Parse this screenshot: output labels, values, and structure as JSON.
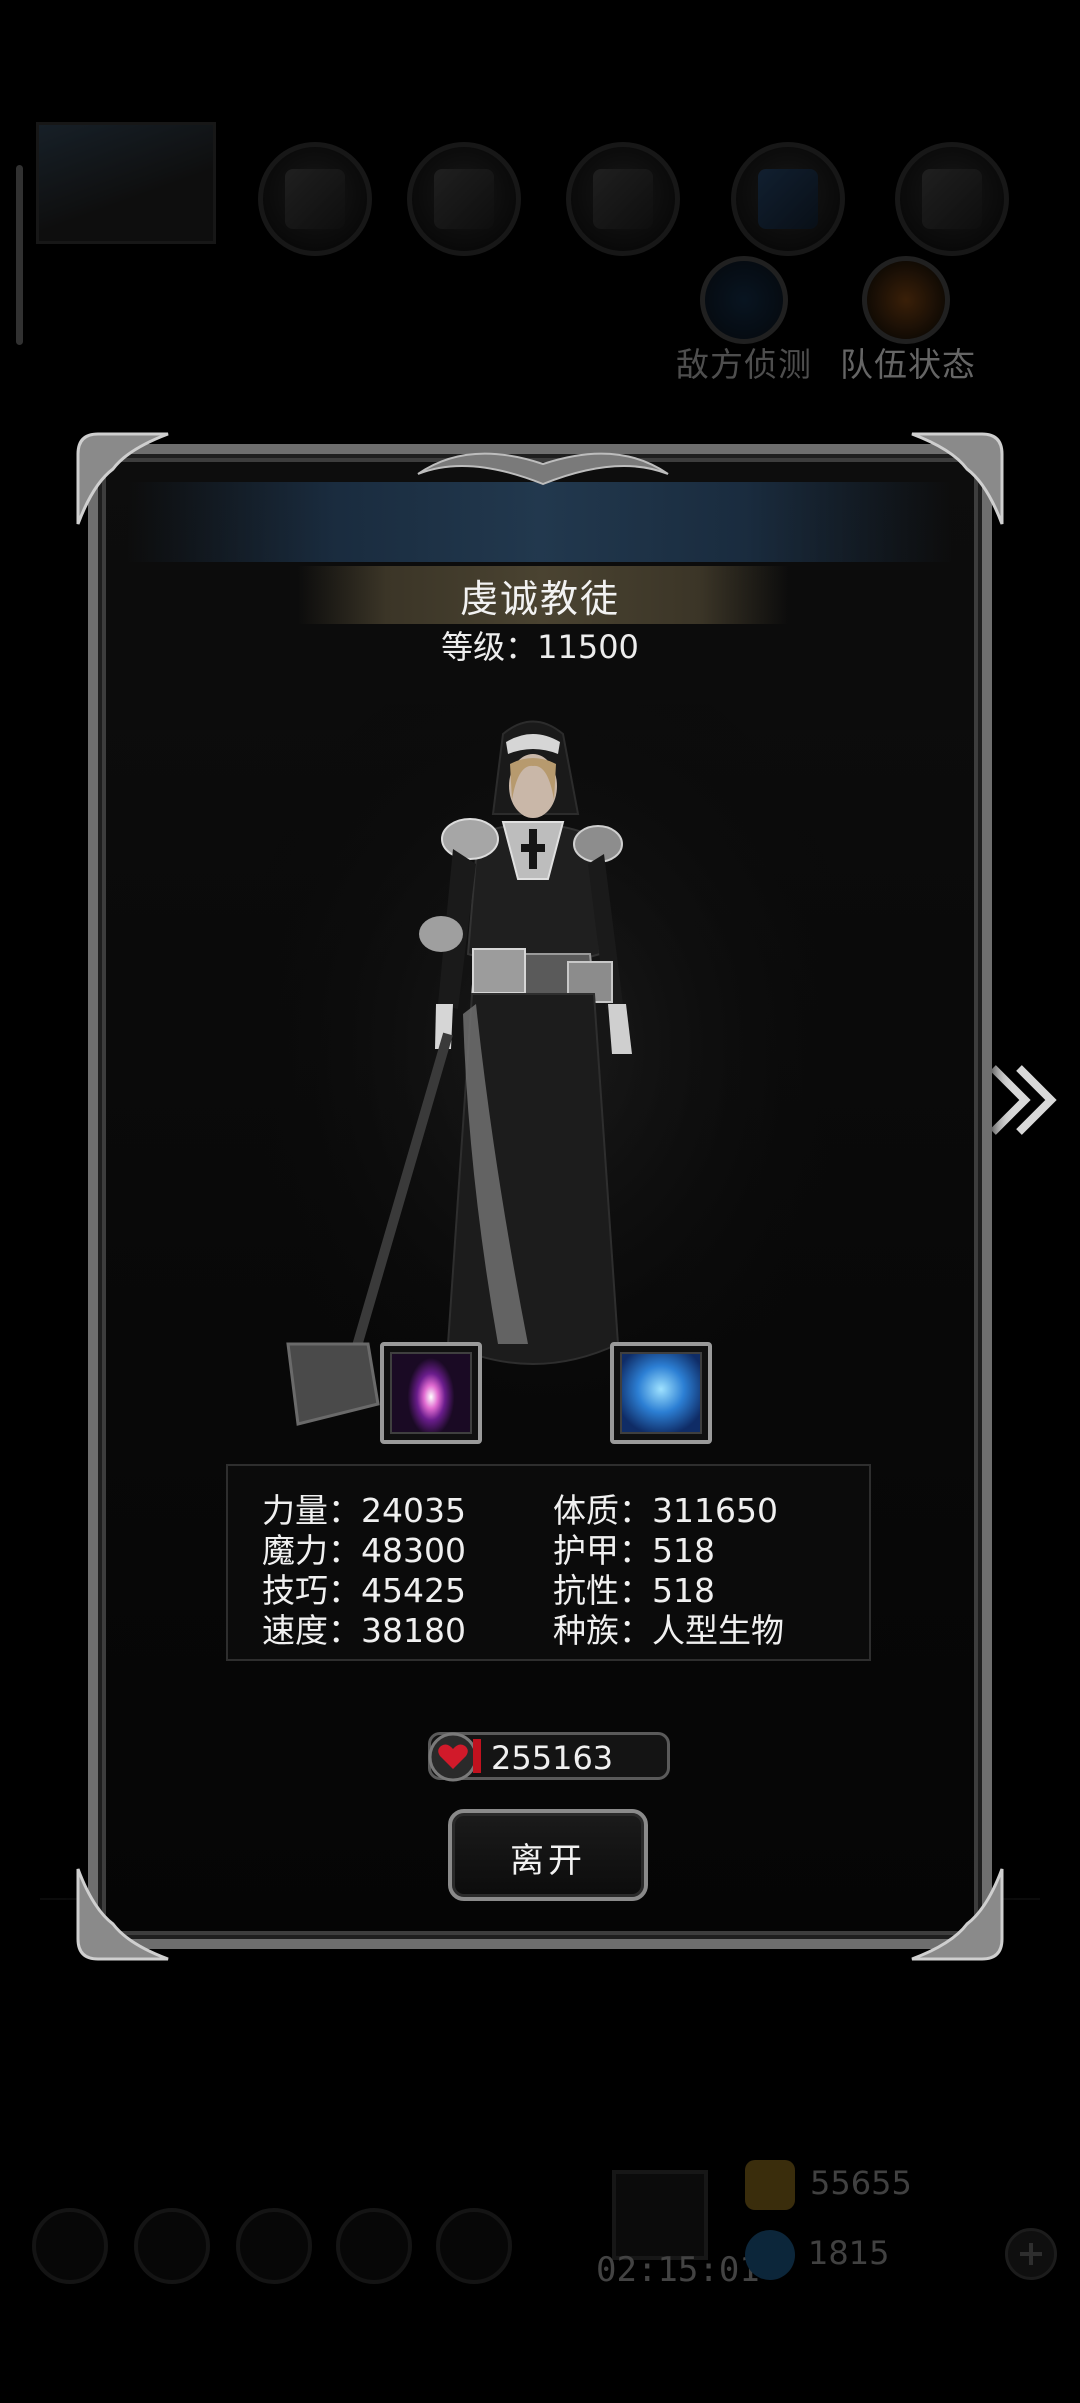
{
  "background": {
    "team_button_label": "队伍状态",
    "enemy_button_label": "敌方侦测",
    "timer": "02:15:01",
    "gold": "55655",
    "gems": "1815"
  },
  "dialog": {
    "name": "虔诚教徒",
    "level_label": "等级",
    "level_value": "11500",
    "skills": [
      "purple-crystal-skill-icon",
      "blue-shield-skill-icon"
    ],
    "stats": [
      {
        "label": "力量",
        "value": "24035"
      },
      {
        "label": "体质",
        "value": "311650"
      },
      {
        "label": "魔力",
        "value": "48300"
      },
      {
        "label": "护甲",
        "value": "518"
      },
      {
        "label": "技巧",
        "value": "45425"
      },
      {
        "label": "抗性",
        "value": "518"
      },
      {
        "label": "速度",
        "value": "38180"
      },
      {
        "label": "种族",
        "value": "人型生物"
      }
    ],
    "hp": "255163",
    "leave_label": "离开"
  },
  "colors": {
    "frame": "#6e6e6e",
    "title_plate": "#4a4331",
    "hp_red": "#c1121f"
  }
}
